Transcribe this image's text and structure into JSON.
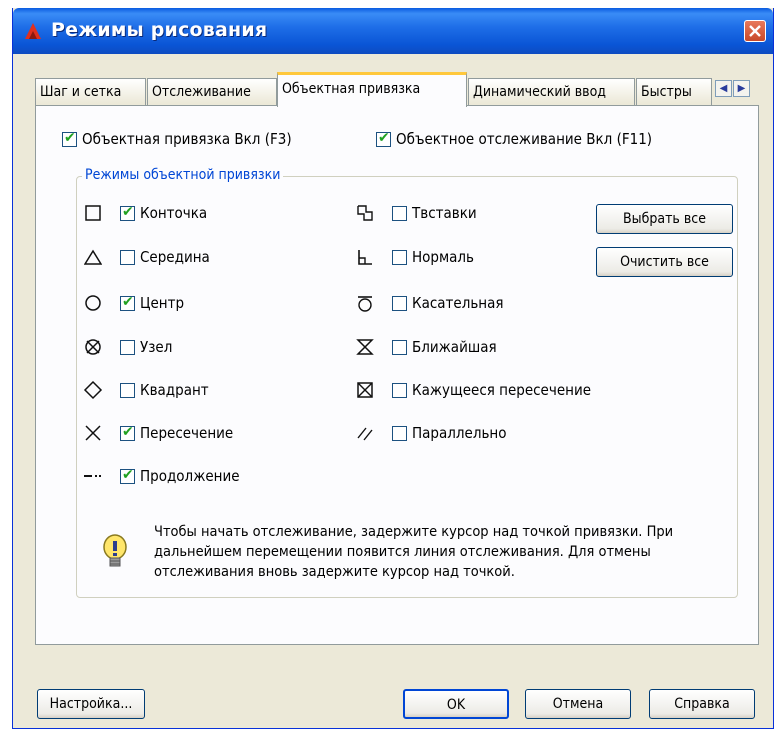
{
  "window": {
    "title": "Режимы рисования"
  },
  "tabs": [
    {
      "label": "Шаг и сетка"
    },
    {
      "label": "Отслеживание"
    },
    {
      "label": "Объектная привязка"
    },
    {
      "label": "Динамический ввод"
    },
    {
      "label": "Быстры"
    }
  ],
  "options": {
    "osnap_on": {
      "label": "Объектная привязка Вкл (F3)",
      "checked": true
    },
    "otrack_on": {
      "label": "Объектное отслеживание Вкл (F11)",
      "checked": true
    }
  },
  "group_title": "Режимы объектной привязки",
  "modes_left": [
    {
      "label": "Конточка",
      "checked": true,
      "icon": "square-icon"
    },
    {
      "label": "Середина",
      "checked": false,
      "icon": "triangle-icon"
    },
    {
      "label": "Центр",
      "checked": true,
      "icon": "circle-icon"
    },
    {
      "label": "Узел",
      "checked": false,
      "icon": "node-icon"
    },
    {
      "label": "Квадрант",
      "checked": false,
      "icon": "diamond-icon"
    },
    {
      "label": "Пересечение",
      "checked": true,
      "icon": "cross-icon"
    },
    {
      "label": "Продолжение",
      "checked": true,
      "icon": "extension-icon"
    }
  ],
  "modes_right": [
    {
      "label": "Твставки",
      "checked": false,
      "icon": "insertion-icon"
    },
    {
      "label": "Нормаль",
      "checked": false,
      "icon": "perpendicular-icon"
    },
    {
      "label": "Касательная",
      "checked": false,
      "icon": "tangent-icon"
    },
    {
      "label": "Ближайшая",
      "checked": false,
      "icon": "nearest-icon"
    },
    {
      "label": "Кажущееся пересечение",
      "checked": false,
      "icon": "apparent-intersection-icon"
    },
    {
      "label": "Параллельно",
      "checked": false,
      "icon": "parallel-icon"
    }
  ],
  "buttons": {
    "select_all": "Выбрать все",
    "clear_all": "Очистить все",
    "settings": "Настройка...",
    "ok": "OK",
    "cancel": "Отмена",
    "help": "Справка"
  },
  "hint": "Чтобы начать отслеживание, задержите курсор над точкой привязки. При дальнейшем перемещении появится линия отслеживания. Для отмены отслеживания вновь задержите курсор над точкой.",
  "colors": {
    "title_bar": "#1f6fe8",
    "group_title": "#0046d5",
    "check": "#21a121",
    "active_tab_top": "#ffc83c"
  }
}
